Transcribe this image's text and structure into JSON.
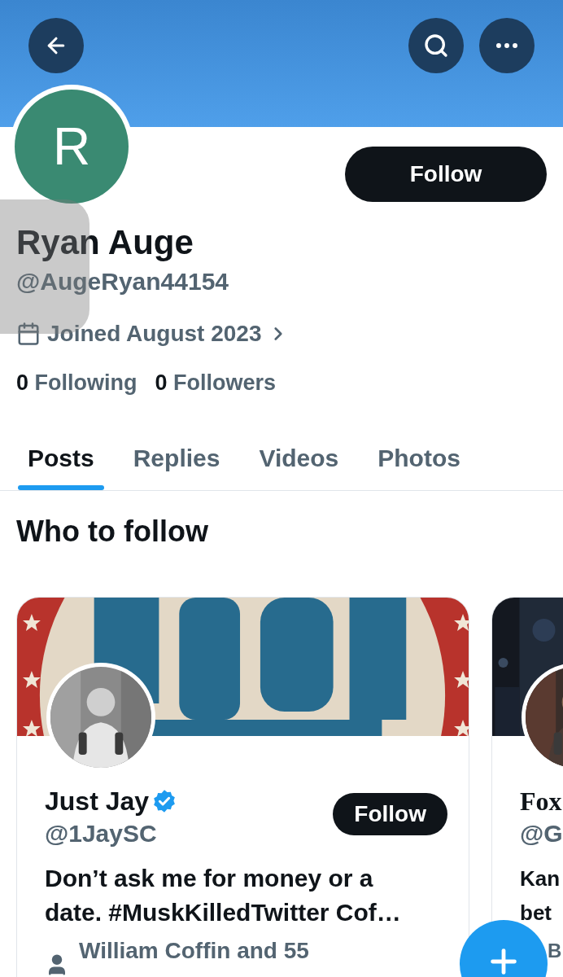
{
  "profile": {
    "avatar_letter": "R",
    "follow_button": "Follow",
    "name": "Ryan Auge",
    "handle": "@AugeRyan44154",
    "joined": "Joined August 2023",
    "following_count": "0",
    "following_label": "Following",
    "followers_count": "0",
    "followers_label": "Followers"
  },
  "tabs": [
    {
      "label": "Posts",
      "selected": true
    },
    {
      "label": "Replies",
      "selected": false
    },
    {
      "label": "Videos",
      "selected": false
    },
    {
      "label": "Photos",
      "selected": false
    }
  ],
  "who_to_follow": {
    "title": "Who to follow",
    "cards": [
      {
        "name": "Just Jay",
        "verified": true,
        "handle": "@1JaySC",
        "follow_button": "Follow",
        "bio_lines": [
          "Don’t ask me for money or a",
          "date. #MuskKilledTwitter Cof…"
        ],
        "followed_by": "William Coffin and 55"
      },
      {
        "name": "Fox",
        "handle": "@G",
        "bio_lines": [
          "Kan",
          "bet"
        ],
        "followed_by": "B"
      }
    ]
  }
}
